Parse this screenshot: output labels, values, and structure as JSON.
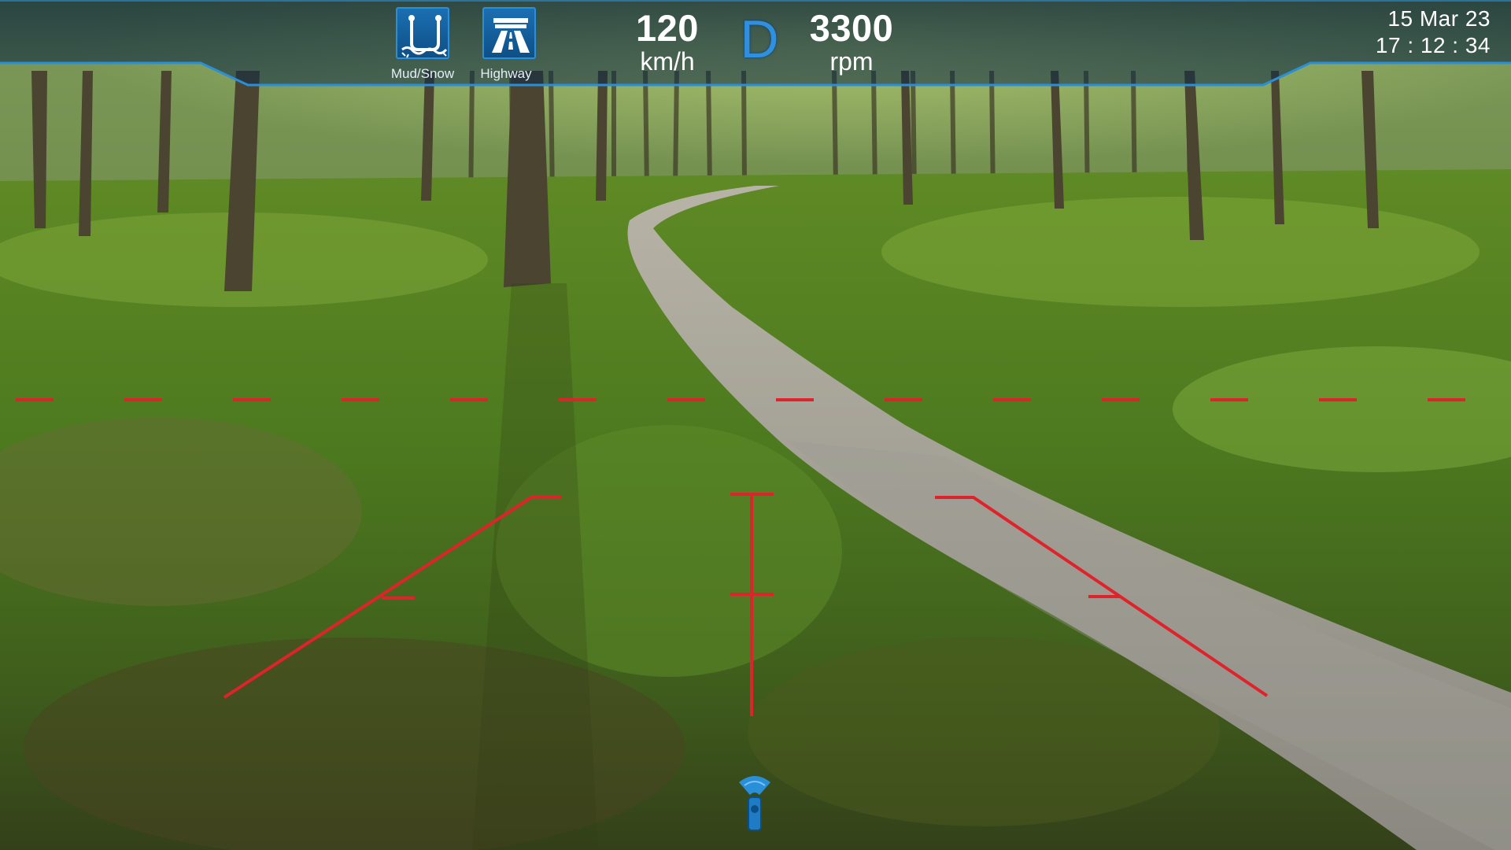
{
  "hud": {
    "modes": [
      {
        "label": "Mud/Snow",
        "icon": "mud-snow-icon"
      },
      {
        "label": "Highway",
        "icon": "highway-icon"
      }
    ],
    "speed": {
      "value": "120",
      "unit": "km/h"
    },
    "gear": "D",
    "rpm": {
      "value": "3300",
      "unit": "rpm"
    },
    "date": "15 Mar 23",
    "time": "17 : 12 : 34"
  },
  "colors": {
    "hud_accent": "#2a8fd9",
    "hud_bar": "#0d2a40",
    "guideline": "#e0222b",
    "gear": "#2f8fe0",
    "sensor": "#2a8fd9"
  },
  "camera": {
    "guidelines": "red",
    "sensor_icon": "parking-sensor-icon"
  }
}
